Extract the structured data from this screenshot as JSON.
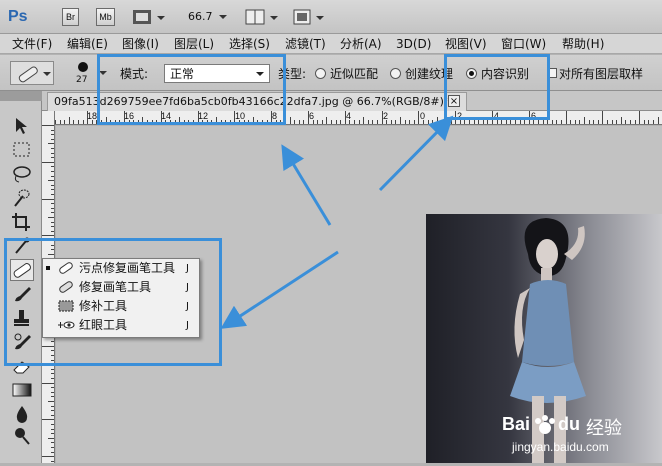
{
  "app": {
    "logo": "Ps",
    "zoom": "66.7"
  },
  "top_buttons": {
    "bridge": "Br",
    "mini_bridge": "Mb"
  },
  "menu": [
    "文件(F)",
    "编辑(E)",
    "图像(I)",
    "图层(L)",
    "选择(S)",
    "滤镜(T)",
    "分析(A)",
    "3D(D)",
    "视图(V)",
    "窗口(W)",
    "帮助(H)"
  ],
  "options": {
    "brush_size": "27",
    "mode_label": "模式:",
    "mode_value": "正常",
    "type_label": "类型:",
    "radio_proximity": "近似匹配",
    "radio_texture": "创建纹理",
    "radio_content_aware": "内容识别",
    "sample_all_layers": "对所有图层取样"
  },
  "document_tab": {
    "title": "09fa513d269759ee7fd6ba5cb0fb43166c22dfa7.jpg @ 66.7%(RGB/8#) *",
    "close": "×"
  },
  "ruler_h_labels": [
    "18",
    "16",
    "14",
    "12",
    "10",
    "8",
    "6",
    "4",
    "2",
    "0",
    "2",
    "4",
    "6"
  ],
  "flyout": {
    "items": [
      {
        "label": "污点修复画笔工具",
        "shortcut": "J",
        "selected": true
      },
      {
        "label": "修复画笔工具",
        "shortcut": "J",
        "selected": false
      },
      {
        "label": "修补工具",
        "shortcut": "J",
        "selected": false
      },
      {
        "label": "红眼工具",
        "shortcut": "J",
        "selected": false
      }
    ]
  },
  "watermark": {
    "brand": "Bai",
    "brand2": "du",
    "text": "经验",
    "url": "jingyan.baidu.com"
  },
  "colors": {
    "highlight": "#3a8fd9",
    "canvas": "#c2c2c2"
  }
}
